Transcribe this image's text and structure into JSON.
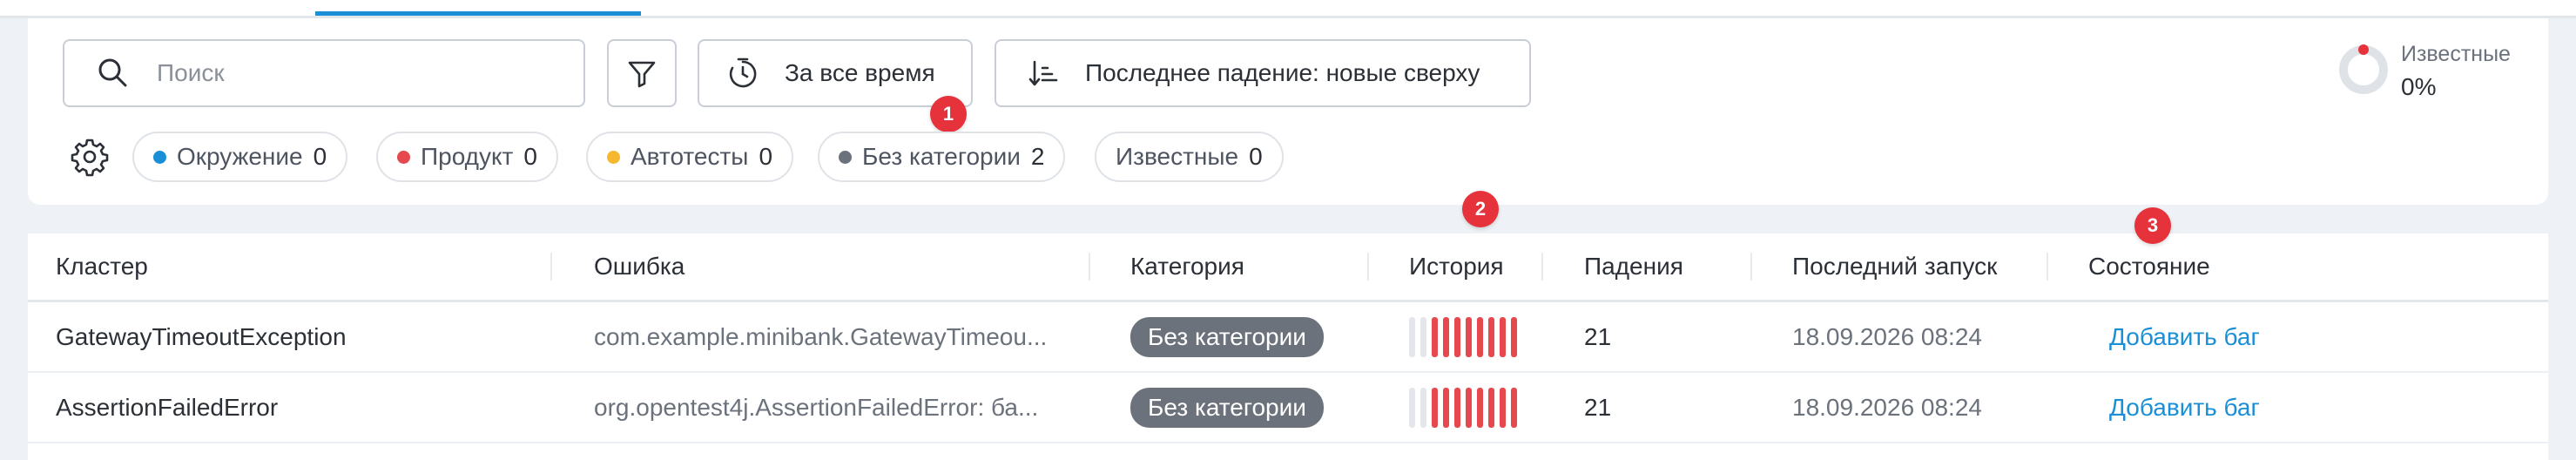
{
  "toolbar": {
    "search_placeholder": "Поиск",
    "time_filter_label": "За все время",
    "sort_label": "Последнее падение: новые сверху"
  },
  "categories": [
    {
      "label": "Окружение",
      "count": "0",
      "color": "#1a8fd6"
    },
    {
      "label": "Продукт",
      "count": "0",
      "color": "#e5484d"
    },
    {
      "label": "Автотесты",
      "count": "0",
      "color": "#f5b82e"
    },
    {
      "label": "Без категории",
      "count": "2",
      "color": "#6c727b"
    },
    {
      "label": "Известные",
      "count": "0"
    }
  ],
  "known_stat": {
    "label": "Известные",
    "value": "0%"
  },
  "markers": [
    "1",
    "2",
    "3"
  ],
  "table": {
    "columns": [
      "Кластер",
      "Ошибка",
      "Категория",
      "История",
      "Падения",
      "Последний запуск",
      "Состояние"
    ],
    "rows": [
      {
        "cluster": "GatewayTimeoutException",
        "error": "com.example.minibank.GatewayTimeou...",
        "category": "Без категории",
        "falls": "21",
        "last_run": "18.09.2026 08:24",
        "action": "Добавить баг"
      },
      {
        "cluster": "AssertionFailedError",
        "error": "org.opentest4j.AssertionFailedError: ба...",
        "category": "Без категории",
        "falls": "21",
        "last_run": "18.09.2026 08:24",
        "action": "Добавить баг"
      }
    ]
  },
  "colors": {
    "accent": "#1a8fd6",
    "marker": "#e5323b",
    "history_fail": "#e5484d",
    "history_empty": "#e3e6ea"
  }
}
